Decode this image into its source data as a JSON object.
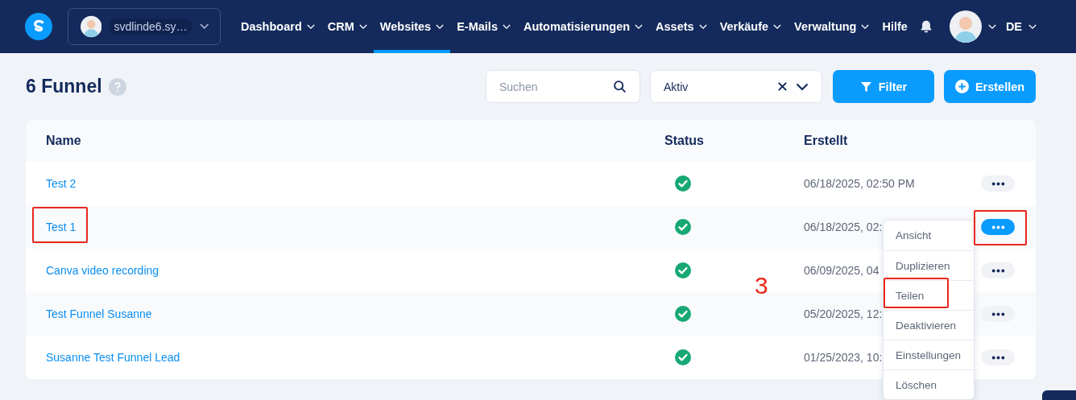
{
  "header": {
    "account": {
      "name": "svdlinde6.sy…"
    },
    "nav": [
      {
        "label": "Dashboard",
        "selected": false,
        "has_menu": true
      },
      {
        "label": "CRM",
        "selected": false,
        "has_menu": true
      },
      {
        "label": "Websites",
        "selected": true,
        "has_menu": true
      },
      {
        "label": "E-Mails",
        "selected": false,
        "has_menu": true
      },
      {
        "label": "Automatisierungen",
        "selected": false,
        "has_menu": true
      },
      {
        "label": "Assets",
        "selected": false,
        "has_menu": true
      },
      {
        "label": "Verkäufe",
        "selected": false,
        "has_menu": true
      },
      {
        "label": "Verwaltung",
        "selected": false,
        "has_menu": true
      },
      {
        "label": "Hilfe",
        "selected": false,
        "has_menu": false
      }
    ],
    "language": "DE"
  },
  "page": {
    "title": "6 Funnel",
    "search": {
      "placeholder": "Suchen"
    },
    "status_filter": {
      "value": "Aktiv"
    },
    "buttons": [
      {
        "kind": "filter",
        "label": "Filter"
      },
      {
        "kind": "create",
        "label": "Erstellen"
      }
    ]
  },
  "table": {
    "columns": [
      "Name",
      "Status",
      "Erstellt"
    ],
    "rows": [
      {
        "name": "Test 2",
        "active": true,
        "created": "06/18/2025, 02:50 PM",
        "menu_open": false
      },
      {
        "name": "Test 1",
        "active": true,
        "created": "06/18/2025, 02:",
        "menu_open": true
      },
      {
        "name": "Canva video recording",
        "active": true,
        "created": "06/09/2025, 04",
        "menu_open": false
      },
      {
        "name": "Test Funnel Susanne",
        "active": true,
        "created": "05/20/2025, 12:",
        "menu_open": false
      },
      {
        "name": "Susanne Test Funnel Lead",
        "active": true,
        "created": "01/25/2023, 10:",
        "menu_open": false
      }
    ]
  },
  "context_menu": {
    "items": [
      {
        "label": "Ansicht"
      },
      {
        "label": "Duplizieren"
      },
      {
        "label": "Teilen"
      },
      {
        "label": "Deaktivieren"
      },
      {
        "label": "Einstellungen"
      },
      {
        "label": "Löschen"
      }
    ]
  },
  "annotations": {
    "step_label": "3"
  }
}
